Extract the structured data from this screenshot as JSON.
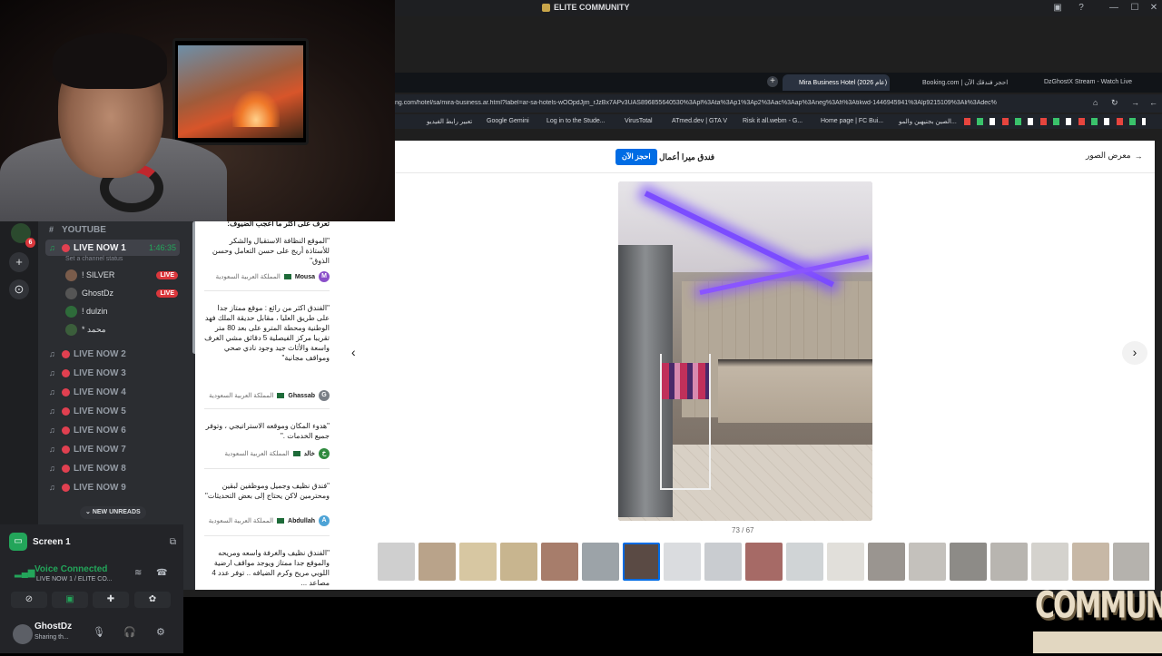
{
  "titlebar": {
    "title": "ELITE COMMUNITY",
    "minimize": "—",
    "maximize": "☐",
    "close": "✕"
  },
  "discord": {
    "category": "YOUTUBE",
    "active_channel": {
      "name": "LIVE NOW 1",
      "timer": "1:46:35",
      "status": "Set a channel status"
    },
    "members": [
      {
        "name": "! SILVER",
        "live": "LIVE"
      },
      {
        "name": "GhostDz",
        "live": "LIVE"
      },
      {
        "name": "! dulzin",
        "live": ""
      },
      {
        "name": "* محمد",
        "live": ""
      }
    ],
    "channels": [
      "LIVE NOW 2",
      "LIVE NOW 3",
      "LIVE NOW 4",
      "LIVE NOW 5",
      "LIVE NOW 6",
      "LIVE NOW 7",
      "LIVE NOW 8",
      "LIVE NOW 9"
    ],
    "new_unreads": "NEW UNREADS",
    "rail_badge": "6",
    "screen_label": "Screen 1",
    "voice_connected": "Voice Connected",
    "voice_sub": "LIVE NOW 1 / ELITE CO...",
    "user": {
      "name": "GhostDz",
      "status": "Sharing th..."
    }
  },
  "browser": {
    "tabs": [
      {
        "label": "Mira Business Hotel (2026 عام)"
      },
      {
        "label": "Booking.com | احجز فندقك الآن"
      },
      {
        "label": "DzGhostX Stream - Watch Live"
      }
    ],
    "url": "ng.com/hotel/sa/mira-business.ar.html?label=ar-sa-hotels-wOOpdJjm_rJzBx7APv3UAS896855640530%3Apl%3Ata%3Ap1%3Ap2%3Aac%3Aap%3Aneg%3Afi%3Atikwd-1446945941%3Alp9215109%3Ali%3Adec%",
    "bookmarks": [
      "تعبير رابط الفيديو",
      "Google Gemini",
      "Log in to the Stude...",
      "VirusTotal",
      "ATmed.dev | GTA V",
      "Risk it all.webm - G...",
      "Home page | FC Bui...",
      "الصين بجنيهين والمو..."
    ]
  },
  "reviews": {
    "intro": "تعرف على أكثر ما أعجب الضيوف:",
    "items": [
      {
        "text": "\"الموقع النظافة الاستقبال والشكر للأستاذة أريج على حسن التعامل وحسن الذوق\"",
        "name": "Mousa",
        "country": "المملكة العربية السعودية",
        "initial": "M",
        "color": "#8a4fc9"
      },
      {
        "text": "\"الفندق اكثر من رائع : موقع ممتاز جدا على طريق العليا ، مقابل حديقة الملك فهد الوطنية ومحطة المترو على بعد 80 متر تقريبا مركز الفيصلية 5 دقائق مشي الغرف واسعة والأثاث جيد وجود نادي صحي ومواقف مجانية\"",
        "name": "Ghassab",
        "country": "المملكة العربية السعودية",
        "initial": "G",
        "color": "#7a7f86"
      },
      {
        "text": "\"هدوء المكان وموقعه الاستراتيجي ، وتوفر جميع الخدمات .\"",
        "name": "خالد",
        "country": "المملكة العربية السعودية",
        "initial": "خ",
        "color": "#2f8a3e"
      },
      {
        "text": "\"فندق نظيف وجميل وموظفين لبقين ومحترمين لاكن يحتاج إلى بعض التحديثات\"",
        "name": "Abdullah",
        "country": "المملكة العربية السعودية",
        "initial": "A",
        "color": "#4da3d6"
      },
      {
        "text": "\"الفندق نظيف والغرفة واسعه ومريحه والموقع جدا ممتاز ويوجد مواقف ارضية اللوبي مريح وكرم الضيافه .. توفر عدد 4 مصاعد ...",
        "name": "",
        "country": "",
        "initial": "",
        "color": "#7a7f86"
      }
    ]
  },
  "gallery": {
    "book_button": "احجز الآن",
    "hotel_name": "فندق ميرا أعمال",
    "gallery_link": "معرض الصور",
    "counter": "73 / 67",
    "prev": "‹",
    "next": "›"
  },
  "overlay": {
    "brand": "COMMUNITY"
  }
}
